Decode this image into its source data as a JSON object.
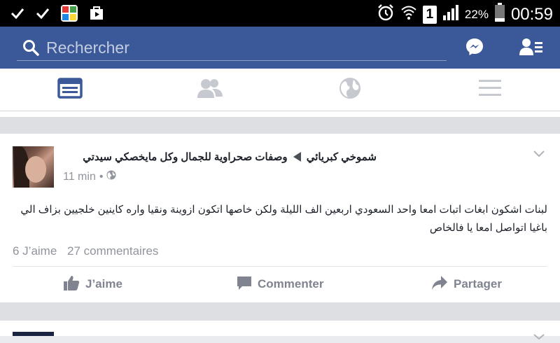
{
  "status_bar": {
    "battery_percent": "22%",
    "sim_slot": "1",
    "clock": "00:59",
    "icons": [
      "check-icon",
      "check-icon",
      "gallery-app-icon",
      "play-store-icon",
      "alarm-icon",
      "wifi-icon",
      "sim-icon",
      "signal-icon",
      "battery-icon"
    ]
  },
  "header": {
    "search_placeholder": "Rechercher",
    "icons": [
      "search-icon",
      "messenger-icon",
      "friend-requests-icon"
    ],
    "brand_color": "#3b5998"
  },
  "tabs": [
    {
      "name": "news-feed",
      "icon": "news-feed-icon",
      "active": true
    },
    {
      "name": "friends",
      "icon": "friends-icon",
      "active": false
    },
    {
      "name": "notifications",
      "icon": "globe-icon",
      "active": false
    },
    {
      "name": "menu",
      "icon": "hamburger-icon",
      "active": false
    }
  ],
  "post": {
    "author": "شموخي كبريائي",
    "group": "وصفات صحراوية للجمال وكل مايخصكي سيدتي",
    "time": "11 min",
    "privacy_icon": "globe-icon",
    "body": "لبنات اشكون ابغات اتبات امعا واحد السعودي  اربعين الف الليلة ولكن خاصها اتكون ازوينة ونقيا واره كاينين خلجيين بزاف الي باغيا اتواصل امعا يا فالخاص",
    "likes": "6 J’aime",
    "comments": "27 commentaires",
    "actions": {
      "like": "J’aime",
      "comment": "Commenter",
      "share": "Partager"
    }
  }
}
